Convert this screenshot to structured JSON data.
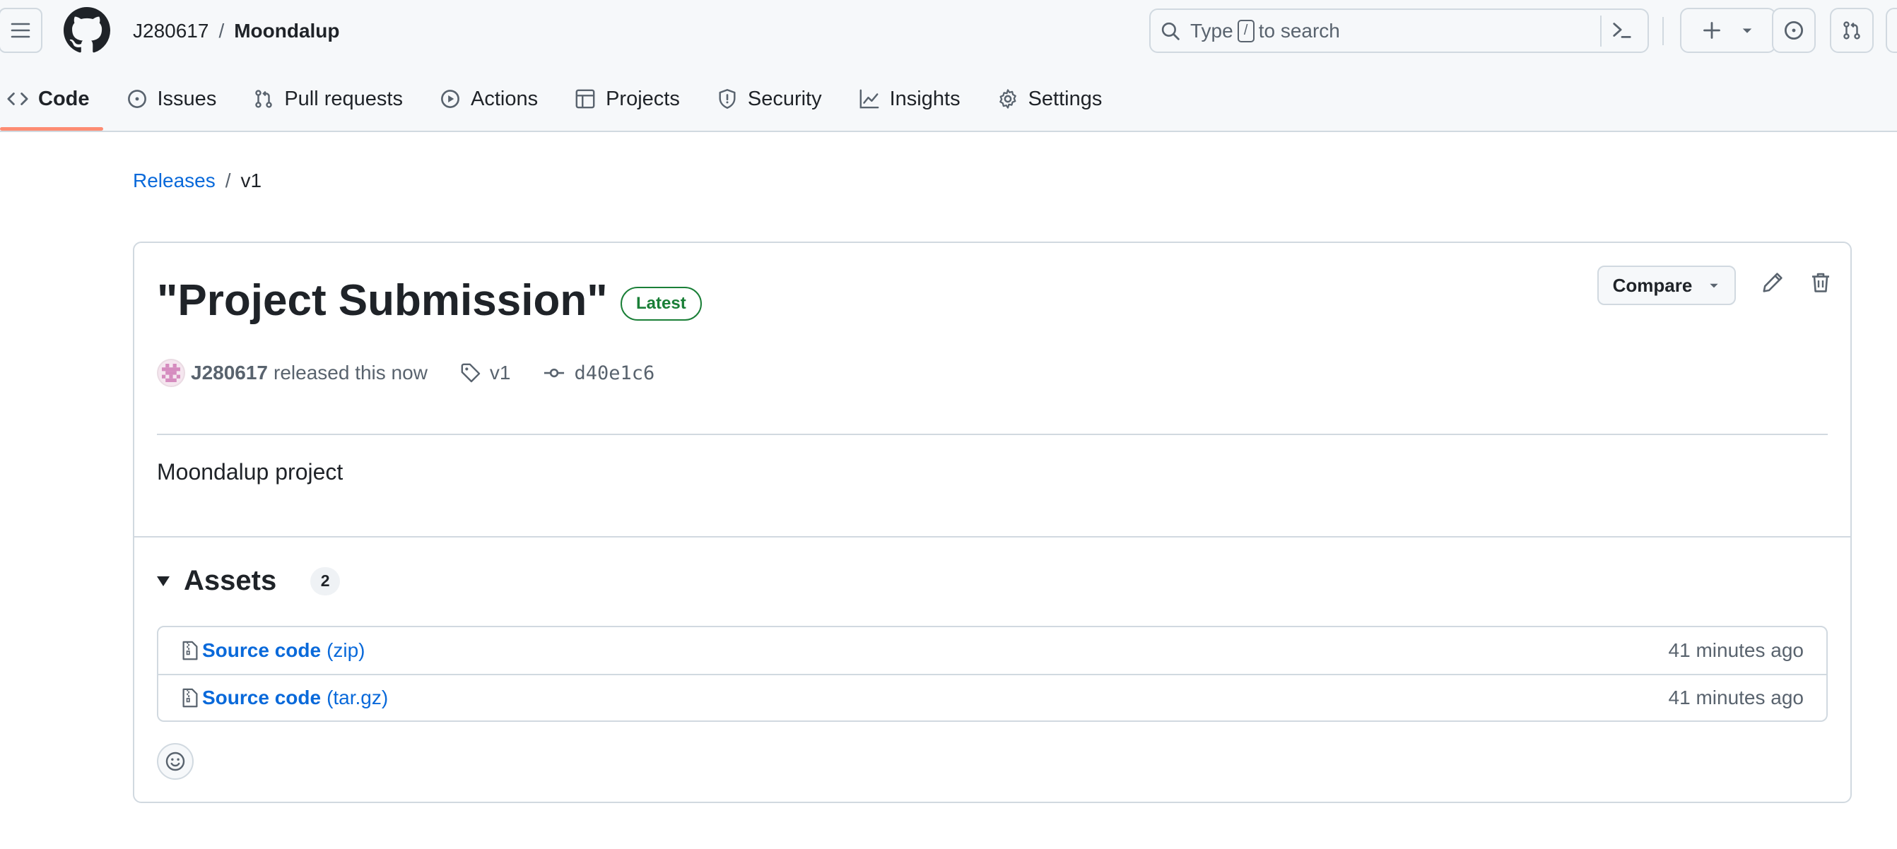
{
  "header": {
    "owner": "J280617",
    "separator": "/",
    "repo": "Moondalup",
    "search_prefix": "Type",
    "search_key": "/",
    "search_suffix": "to search"
  },
  "tabs": [
    {
      "label": "Code",
      "icon": "code-icon",
      "active": true
    },
    {
      "label": "Issues",
      "icon": "issue-icon"
    },
    {
      "label": "Pull requests",
      "icon": "pull-request-icon"
    },
    {
      "label": "Actions",
      "icon": "play-icon"
    },
    {
      "label": "Projects",
      "icon": "table-icon"
    },
    {
      "label": "Security",
      "icon": "shield-icon"
    },
    {
      "label": "Insights",
      "icon": "graph-icon"
    },
    {
      "label": "Settings",
      "icon": "gear-icon"
    }
  ],
  "breadcrumb": {
    "parent": "Releases",
    "sep": "/",
    "current": "v1"
  },
  "release": {
    "title": "\"Project Submission\"",
    "badge": "Latest",
    "compare_label": "Compare",
    "author": "J280617",
    "released_text": "released this now",
    "tag": "v1",
    "commit": "d40e1c6",
    "body": "Moondalup project"
  },
  "assets": {
    "label": "Assets",
    "count": "2",
    "items": [
      {
        "name": "Source code",
        "format": "(zip)",
        "time": "41 minutes ago"
      },
      {
        "name": "Source code",
        "format": "(tar.gz)",
        "time": "41 minutes ago"
      }
    ]
  },
  "colors": {
    "link": "#0969da",
    "latest_green": "#1a7f37",
    "tab_underline": "#fd8c73"
  }
}
